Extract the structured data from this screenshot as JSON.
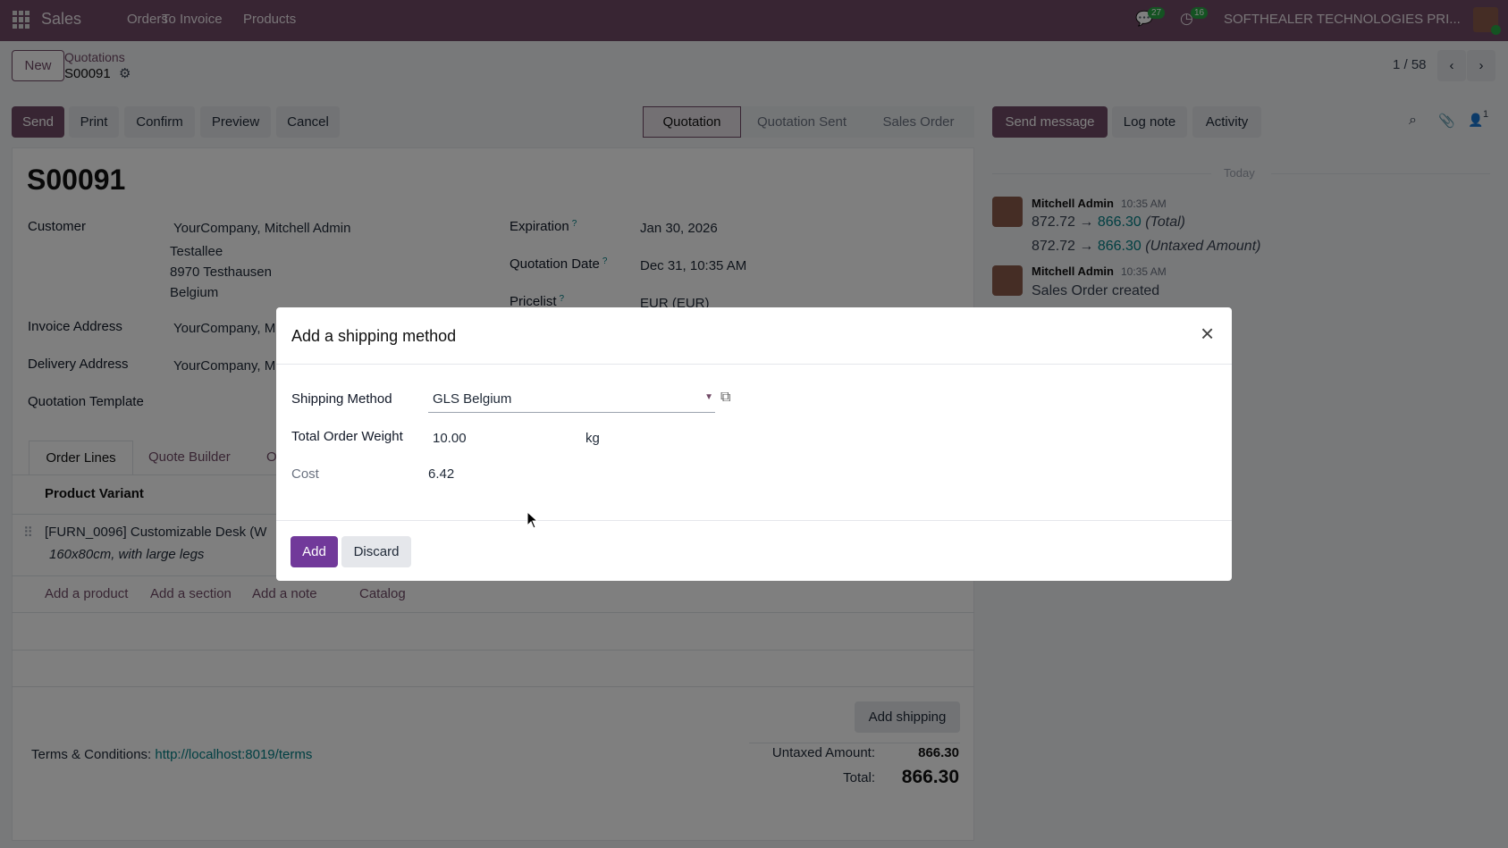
{
  "navbar": {
    "app": "Sales",
    "menu": [
      "Orders",
      "To Invoice",
      "Products"
    ],
    "messages_count": "27",
    "activities_count": "16",
    "company": "SOFTHEALER TECHNOLOGIES PRI..."
  },
  "control": {
    "new_label": "New",
    "breadcrumb": "Quotations",
    "record": "S00091",
    "pager": "1 / 58"
  },
  "actions": [
    "Send",
    "Print",
    "Confirm",
    "Preview",
    "Cancel"
  ],
  "statusbar": [
    "Quotation",
    "Quotation Sent",
    "Sales Order"
  ],
  "chatter": {
    "send_message": "Send message",
    "log_note": "Log note",
    "activity": "Activity",
    "followers": "1",
    "date_sep": "Today",
    "messages": [
      {
        "author": "Mitchell Admin",
        "time": "10:35 AM",
        "changes": [
          {
            "old": "872.72",
            "arrow": "→",
            "new": "866.30",
            "field": "(Total)"
          },
          {
            "old": "872.72",
            "arrow": "→",
            "new": "866.30",
            "field": "(Untaxed Amount)"
          }
        ]
      },
      {
        "author": "Mitchell Admin",
        "time": "10:35 AM",
        "body": "Sales Order created"
      }
    ]
  },
  "form": {
    "title": "S00091",
    "customer_label": "Customer",
    "customer": "YourCompany, Mitchell Admin",
    "address": [
      "Testallee",
      "8970 Testhausen",
      "Belgium"
    ],
    "expiration_label": "Expiration",
    "expiration": "Jan 30, 2026",
    "qdate_label": "Quotation Date",
    "qdate": "Dec 31, 10:35 AM",
    "pricelist_label": "Pricelist",
    "pricelist": "EUR (EUR)",
    "help": "?",
    "invoice_label": "Invoice Address",
    "invoice": "YourCompany, M",
    "delivery_label": "Delivery Address",
    "delivery": "YourCompany, M",
    "template_label": "Quotation Template",
    "tabs": [
      "Order Lines",
      "Quote Builder",
      "O"
    ],
    "col_header": "Product Variant",
    "line": {
      "name": "[FURN_0096] Customizable Desk (W",
      "desc": "160x80cm, with large legs"
    },
    "add_links": [
      "Add a product",
      "Add a section",
      "Add a note",
      "Catalog"
    ],
    "add_shipping": "Add shipping",
    "terms_label": "Terms & Conditions:",
    "terms_link": "http://localhost:8019/terms",
    "untaxed_label": "Untaxed Amount:",
    "untaxed": "866.30",
    "total_label": "Total:",
    "total": "866.30"
  },
  "modal": {
    "title": "Add a shipping method",
    "method_label": "Shipping Method",
    "method": "GLS Belgium",
    "weight_label": "Total Order Weight",
    "weight": "10.00",
    "weight_unit": "kg",
    "cost_label": "Cost",
    "cost": "6.42",
    "add": "Add",
    "discard": "Discard"
  }
}
